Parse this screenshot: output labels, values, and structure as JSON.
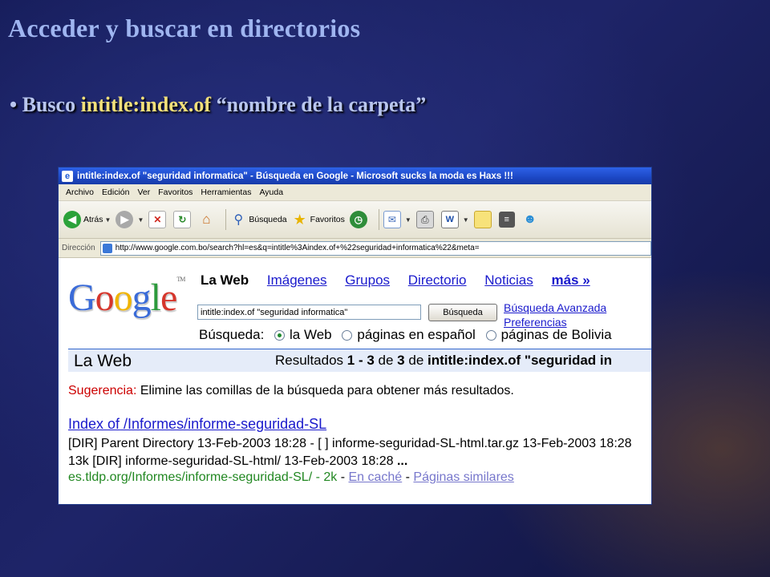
{
  "slide": {
    "title": "Acceder y buscar en directorios",
    "bullet_prefix": "• Busco ",
    "bullet_highlight": "intitle:index.of",
    "bullet_rest": " “nombre de la carpeta”"
  },
  "browser": {
    "title": "intitle:index.of \"seguridad informatica\" - Búsqueda en Google - Microsoft sucks la moda es Haxs !!!",
    "menu": [
      "Archivo",
      "Edición",
      "Ver",
      "Favoritos",
      "Herramientas",
      "Ayuda"
    ],
    "toolbar": {
      "back_label": "Atrás",
      "search_label": "Búsqueda",
      "favorites_label": "Favoritos"
    },
    "address_label": "Dirección",
    "address_url": "http://www.google.com.bo/search?hl=es&q=intitle%3Aindex.of+%22seguridad+informatica%22&meta="
  },
  "google": {
    "logo": {
      "g1": "G",
      "o1": "o",
      "o2": "o",
      "g2": "g",
      "l": "l",
      "e": "e",
      "tm": "TM"
    },
    "tabs": {
      "active": "La Web",
      "images": "Imágenes",
      "groups": "Grupos",
      "directory": "Directorio",
      "news": "Noticias",
      "more": "más »"
    },
    "query": "intitle:index.of \"seguridad informatica\"",
    "search_button": "Búsqueda",
    "advanced_link": "Búsqueda Avanzada",
    "prefs_link": "Preferencias",
    "scope_label": "Búsqueda:",
    "scope_options": [
      "la Web",
      "páginas en español",
      "páginas de Bolivia"
    ],
    "results_bar": {
      "left": "La Web",
      "prefix": "Resultados ",
      "range": "1 - 3",
      "of": " de ",
      "total": "3",
      "for": " de ",
      "query_bold": "intitle:index.of \"seguridad in"
    },
    "suggestion_label": "Sugerencia:",
    "suggestion_text": " Elimine las comillas de la búsqueda para obtener más resultados.",
    "result": {
      "title_bold": "Index of",
      "title_rest": " /Informes/informe-seguridad-SL",
      "snippet": "[DIR] Parent Directory 13-Feb-2003 18:28 - [ ] informe-seguridad-SL-html.tar.gz 13-Feb-2003 18:28 13k [DIR] informe-seguridad-SL-html/ 13-Feb-2003 18:28 ",
      "snippet_end": "...",
      "url": "es.tldp.org/Informes/informe-seguridad-SL/ - 2k",
      "sep1": " - ",
      "cache": "En caché",
      "sep2": " - ",
      "similar": "Páginas similares"
    }
  }
}
